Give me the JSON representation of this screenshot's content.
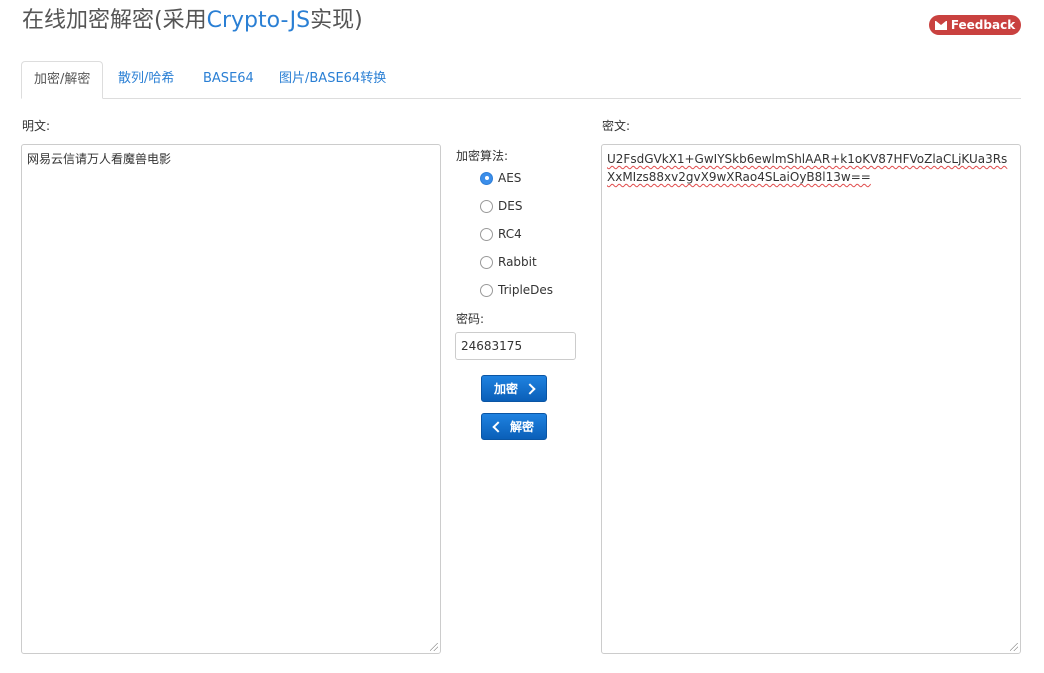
{
  "header": {
    "title_prefix": "在线加密解密(采用",
    "title_highlight": "Crypto-JS",
    "title_suffix": "实现)",
    "feedback_label": "Feedback"
  },
  "tabs": [
    {
      "label": "加密/解密",
      "active": true
    },
    {
      "label": "散列/哈希",
      "active": false
    },
    {
      "label": "BASE64",
      "active": false
    },
    {
      "label": "图片/BASE64转换",
      "active": false
    }
  ],
  "plaintext": {
    "label": "明文:",
    "value": "网易云信请万人看魔兽电影"
  },
  "algorithm": {
    "label": "加密算法:",
    "options": [
      "AES",
      "DES",
      "RC4",
      "Rabbit",
      "TripleDes"
    ],
    "selected": "AES"
  },
  "password": {
    "label": "密码:",
    "value": "24683175"
  },
  "buttons": {
    "encrypt": "加密",
    "decrypt": "解密"
  },
  "ciphertext": {
    "label": "密文:",
    "value": "U2FsdGVkX1+GwIYSkb6ewlmShlAAR+k1oKV87HFVoZlaCLjKUa3RsXxMIzs88xv2gvX9wXRao4SLaiOyB8l13w=="
  },
  "colors": {
    "accent": "#2a7fd4",
    "feedback_bg": "#c9413f",
    "button_bg": "#0f6cc9"
  }
}
